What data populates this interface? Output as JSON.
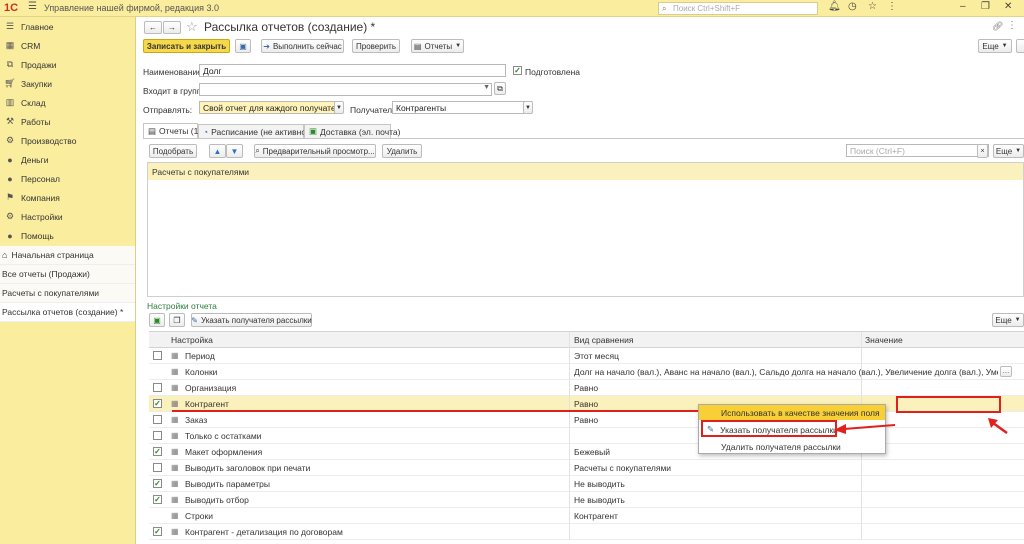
{
  "app": {
    "logo": "1С",
    "title": "Управление нашей фирмой, редакция 3.0",
    "search_placeholder": "Поиск Ctrl+Shift+F"
  },
  "sidebar": {
    "items": [
      {
        "label": "Главное",
        "icon": "menu-icon"
      },
      {
        "label": "CRM",
        "icon": "crm-icon"
      },
      {
        "label": "Продажи",
        "icon": "sales-icon"
      },
      {
        "label": "Закупки",
        "icon": "purchases-icon"
      },
      {
        "label": "Склад",
        "icon": "warehouse-icon"
      },
      {
        "label": "Работы",
        "icon": "work-icon"
      },
      {
        "label": "Производство",
        "icon": "production-icon"
      },
      {
        "label": "Деньги",
        "icon": "money-icon"
      },
      {
        "label": "Персонал",
        "icon": "personnel-icon"
      },
      {
        "label": "Компания",
        "icon": "company-icon"
      },
      {
        "label": "Настройки",
        "icon": "settings-icon"
      },
      {
        "label": "Помощь",
        "icon": "help-icon"
      }
    ],
    "open": [
      {
        "label": "Начальная страница"
      },
      {
        "label": "Все отчеты (Продажи)"
      },
      {
        "label": "Расчеты с покупателями"
      },
      {
        "label": "Рассылка отчетов (создание) *"
      }
    ]
  },
  "form": {
    "title": "Рассылка отчетов (создание) *",
    "toolbar": {
      "save_close": "Записать и закрыть",
      "run_now": "Выполнить сейчас",
      "check": "Проверить",
      "reports": "Отчеты",
      "more": "Еще"
    },
    "name_label": "Наименование:",
    "name_value": "Долг",
    "prepared_label": "Подготовлена",
    "group_label": "Входит в группу:",
    "send_label": "Отправлять:",
    "send_value": "Свой отчет для каждого получателя",
    "recipients_label": "Получатели:",
    "recipients_value": "Контрагенты",
    "tabs": [
      {
        "label": "Отчеты (1)"
      },
      {
        "label": "Расписание (не активно)"
      },
      {
        "label": "Доставка (эл. почта)"
      }
    ],
    "reports_toolbar": {
      "pick": "Подобрать",
      "preview": "Предварительный просмотр...",
      "delete": "Удалить",
      "search_placeholder": "Поиск (Ctrl+F)",
      "more": "Еще"
    },
    "reports_list": [
      "Расчеты с покупателями"
    ],
    "settings": {
      "title": "Настройки отчета",
      "specify": "Указать получателя рассылки",
      "more": "Еще",
      "columns": [
        "Настройка",
        "Вид сравнения",
        "Значение"
      ],
      "rows": [
        {
          "check": false,
          "label": "Период",
          "compare": "Этот месяц"
        },
        {
          "check": null,
          "label": "Колонки",
          "compare": "Долг на начало (вал.), Аванс на начало (вал.), Сальдо долга на начало (вал.), Увеличение долга (вал.), Уменьшение долга (вал.), П..."
        },
        {
          "check": false,
          "label": "Организация",
          "compare": "Равно"
        },
        {
          "check": true,
          "label": "Контрагент",
          "compare": "Равно"
        },
        {
          "check": false,
          "label": "Заказ",
          "compare": "Равно"
        },
        {
          "check": false,
          "label": "Только с остатками",
          "compare": ""
        },
        {
          "check": true,
          "label": "Макет оформления",
          "compare": "Бежевый"
        },
        {
          "check": false,
          "label": "Выводить заголовок при печати",
          "compare": "Расчеты с покупателями"
        },
        {
          "check": true,
          "label": "Выводить параметры",
          "compare": "Не выводить"
        },
        {
          "check": true,
          "label": "Выводить отбор",
          "compare": "Не выводить"
        },
        {
          "check": null,
          "label": "Строки",
          "compare": "Контрагент"
        },
        {
          "check": true,
          "label": "Контрагент - детализация по договорам",
          "compare": ""
        }
      ]
    }
  },
  "context_menu": {
    "items": [
      "Использовать в качестве значения поля",
      "Указать получателя рассылки",
      "Удалить получателя рассылки"
    ]
  },
  "colors": {
    "sidebar": "#fbed9e",
    "accent_button": "#f6d94a",
    "highlight": "#e0201c",
    "selected_row": "#fbf1bd"
  }
}
